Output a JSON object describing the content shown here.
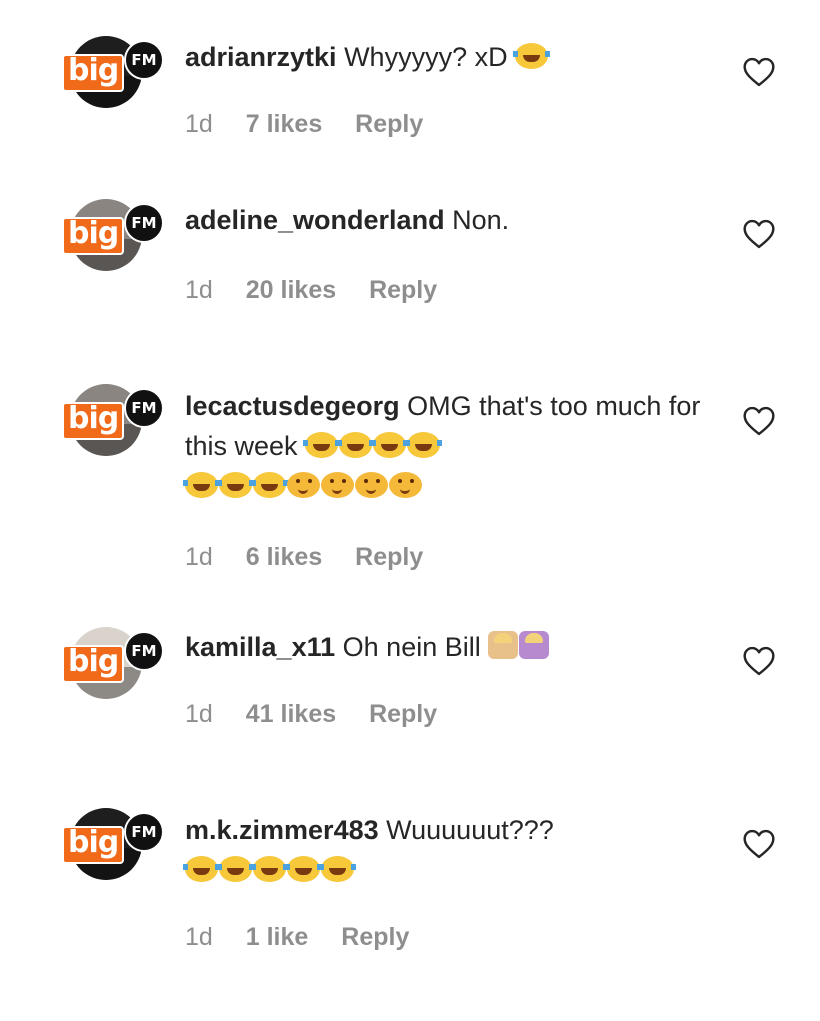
{
  "comments": [
    {
      "username": "adrianrzytki",
      "text": "Whyyyyy? xD",
      "emoji_line1": [
        "laugh"
      ],
      "emoji_line2": [],
      "time": "1d",
      "likes": "7 likes",
      "reply": "Reply",
      "avatar_style": "dark",
      "badge": {
        "big": "big",
        "fm": "FM"
      }
    },
    {
      "username": "adeline_wonderland",
      "text": "Non.",
      "emoji_line1": [],
      "emoji_line2": [],
      "time": "1d",
      "likes": "20 likes",
      "reply": "Reply",
      "avatar_style": "mid",
      "badge": {
        "big": "big",
        "fm": "FM"
      }
    },
    {
      "username": "lecactusdegeorg",
      "text": "OMG that's too much for this week",
      "emoji_line1": [
        "laugh",
        "laugh",
        "laugh",
        "laugh"
      ],
      "emoji_line2": [
        "laugh",
        "laugh",
        "laugh",
        "woozy",
        "woozy",
        "woozy",
        "woozy"
      ],
      "time": "1d",
      "likes": "6 likes",
      "reply": "Reply",
      "avatar_style": "mid",
      "badge": {
        "big": "big",
        "fm": "FM"
      }
    },
    {
      "username": "kamilla_x11",
      "text": "Oh nein Bill",
      "emoji_line1": [
        "person",
        "person b"
      ],
      "emoji_line2": [],
      "time": "1d",
      "likes": "41 likes",
      "reply": "Reply",
      "avatar_style": "light",
      "badge": {
        "big": "big",
        "fm": "FM"
      }
    },
    {
      "username": "m.k.zimmer483",
      "text": "Wuuuuuut???",
      "emoji_line1": [],
      "emoji_line2": [
        "laugh",
        "laugh",
        "laugh",
        "laugh",
        "laugh"
      ],
      "time": "1d",
      "likes": "1 like",
      "reply": "Reply",
      "avatar_style": "dark",
      "badge": {
        "big": "big",
        "fm": "FM"
      }
    }
  ],
  "icons": {
    "like": "heart-outline-icon"
  },
  "colors": {
    "badge_orange": "#f06a1a",
    "meta_gray": "#8e8e8e",
    "text": "#262626"
  }
}
